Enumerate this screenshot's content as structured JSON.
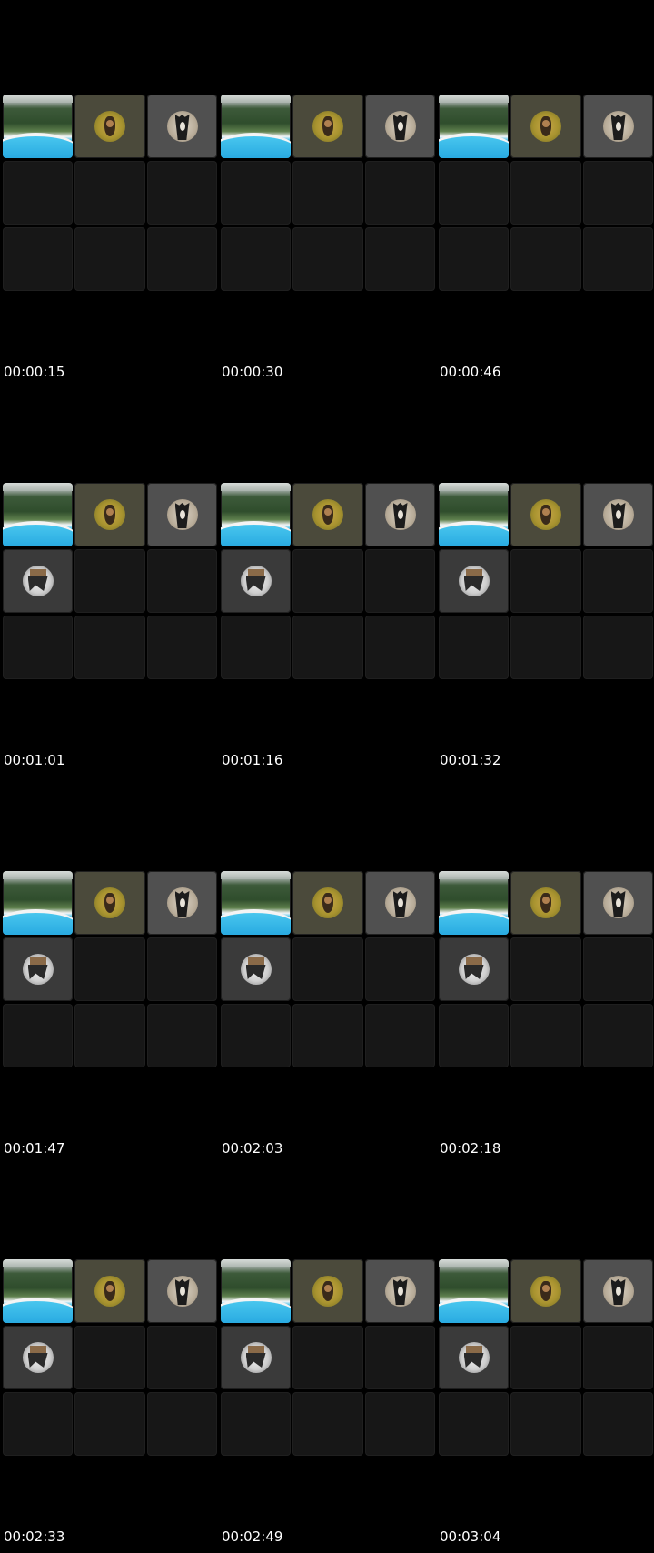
{
  "timestamps": [
    "00:00:15",
    "00:00:30",
    "00:00:46",
    "00:01:01",
    "00:01:16",
    "00:01:32",
    "00:01:47",
    "00:02:03",
    "00:02:18",
    "00:02:33",
    "00:02:49",
    "00:03:04"
  ],
  "tile_layouts": {
    "three": [
      "pool-preview",
      "dog-avatar",
      "cat-avatar",
      "empty",
      "empty",
      "empty",
      "empty",
      "empty",
      "empty"
    ],
    "four": [
      "pool-preview",
      "dog-avatar",
      "cat-avatar",
      "room-avatar",
      "empty",
      "empty",
      "empty",
      "empty",
      "empty"
    ]
  },
  "frame_layouts": [
    "three",
    "three",
    "three",
    "four",
    "four",
    "four",
    "four",
    "four",
    "four",
    "four",
    "four",
    "four"
  ],
  "colors": {
    "background": "#000000",
    "empty_tile": "#171717",
    "timestamp_text": "#ffffff"
  }
}
